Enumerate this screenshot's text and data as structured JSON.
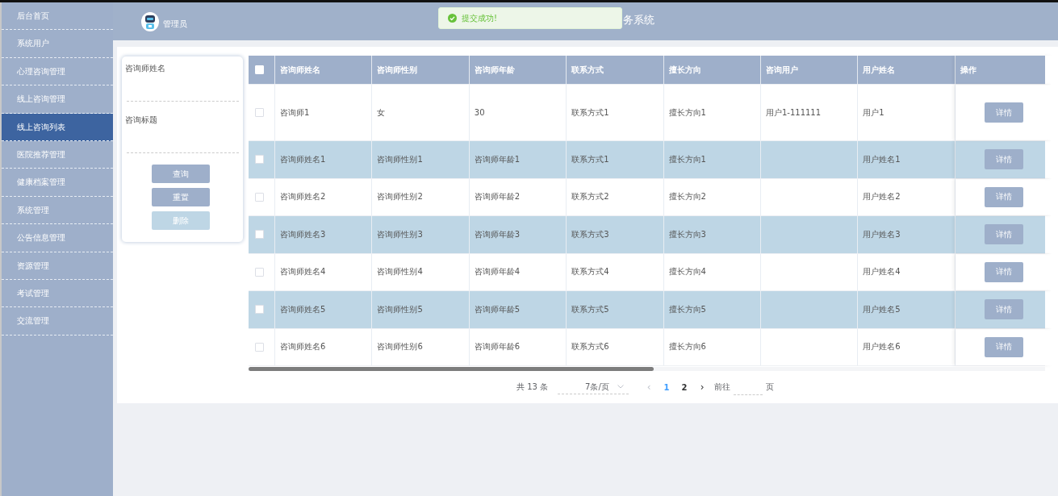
{
  "sidebar": {
    "items": [
      {
        "label": "后台首页",
        "selected": false
      },
      {
        "label": "系统用户",
        "selected": false
      },
      {
        "label": "心理咨询管理",
        "selected": false
      },
      {
        "label": "线上咨询管理",
        "selected": false
      },
      {
        "label": "线上咨询列表",
        "selected": true
      },
      {
        "label": "医院推荐管理",
        "selected": false
      },
      {
        "label": "健康档案管理",
        "selected": false
      },
      {
        "label": "系统管理",
        "selected": false
      },
      {
        "label": "公告信息管理",
        "selected": false
      },
      {
        "label": "资源管理",
        "selected": false
      },
      {
        "label": "考试管理",
        "selected": false
      },
      {
        "label": "交流管理",
        "selected": false
      }
    ]
  },
  "header": {
    "user": "管理员",
    "title": "务系统"
  },
  "toast": {
    "kind": "success",
    "message": "提交成功!"
  },
  "search": {
    "fields": [
      {
        "label": "咨询师姓名"
      },
      {
        "label": "咨询标题"
      }
    ],
    "buttons": [
      {
        "label": "查询",
        "disabled": false
      },
      {
        "label": "重置",
        "disabled": false
      },
      {
        "label": "删除",
        "disabled": true
      }
    ]
  },
  "table": {
    "all_checked": false,
    "columns": [
      "咨询师姓名",
      "咨询师性别",
      "咨询师年龄",
      "联系方式",
      "擅长方向",
      "咨询用户",
      "用户姓名",
      "操作"
    ],
    "rows": [
      {
        "checked": false,
        "cells": [
          "咨询师1",
          "女",
          "30",
          "联系方式1",
          "擅长方向1",
          "用户1-111111",
          "用户1"
        ],
        "action": "详情"
      },
      {
        "checked": false,
        "cells": [
          "咨询师姓名1",
          "咨询师性别1",
          "咨询师年龄1",
          "联系方式1",
          "擅长方向1",
          "",
          "用户姓名1"
        ],
        "action": "详情"
      },
      {
        "checked": false,
        "cells": [
          "咨询师姓名2",
          "咨询师性别2",
          "咨询师年龄2",
          "联系方式2",
          "擅长方向2",
          "",
          "用户姓名2"
        ],
        "action": "详情"
      },
      {
        "checked": false,
        "cells": [
          "咨询师姓名3",
          "咨询师性别3",
          "咨询师年龄3",
          "联系方式3",
          "擅长方向3",
          "",
          "用户姓名3"
        ],
        "action": "详情"
      },
      {
        "checked": false,
        "cells": [
          "咨询师姓名4",
          "咨询师性别4",
          "咨询师年龄4",
          "联系方式4",
          "擅长方向4",
          "",
          "用户姓名4"
        ],
        "action": "详情"
      },
      {
        "checked": false,
        "cells": [
          "咨询师姓名5",
          "咨询师性别5",
          "咨询师年龄5",
          "联系方式5",
          "擅长方向5",
          "",
          "用户姓名5"
        ],
        "action": "详情"
      },
      {
        "checked": false,
        "cells": [
          "咨询师姓名6",
          "咨询师性别6",
          "咨询师年龄6",
          "联系方式6",
          "擅长方向6",
          "",
          "用户姓名6"
        ],
        "action": "详情"
      }
    ]
  },
  "pagination": {
    "total": "共 13 条",
    "page_size": "7条/页",
    "prev": "‹",
    "pages": [
      {
        "label": "1",
        "selected": true
      },
      {
        "label": "2",
        "selected": false
      }
    ],
    "next": "›",
    "goto": "前往",
    "goto_unit": "页"
  }
}
